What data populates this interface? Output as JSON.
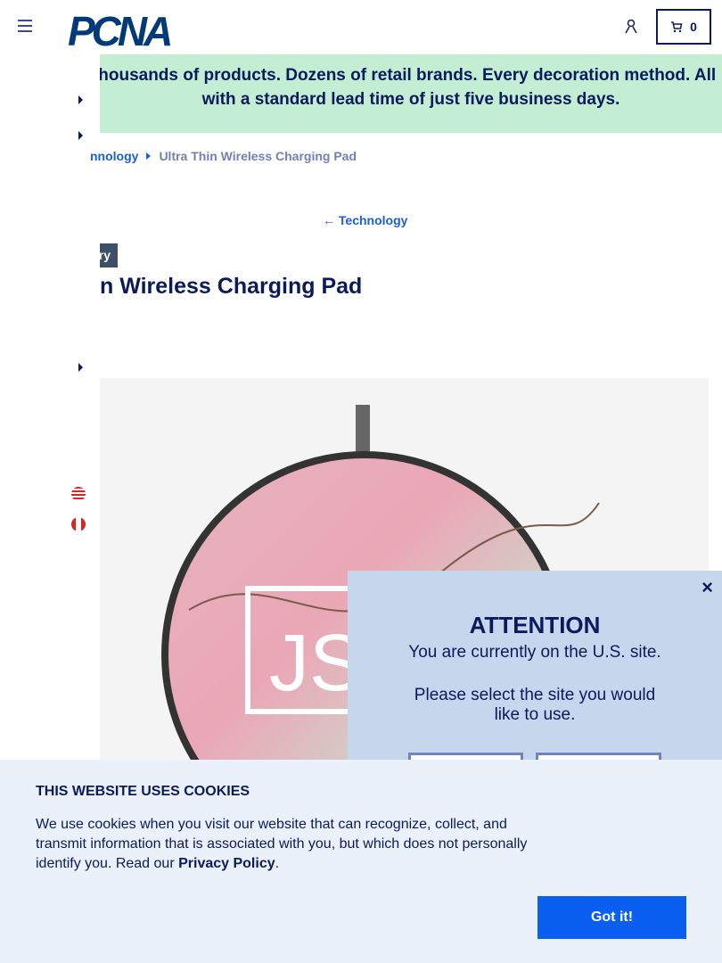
{
  "header": {
    "logo": "PCNA",
    "cart_count": "0"
  },
  "banner": {
    "text_line1": "' Thousands of products. Dozens of retail brands. Every decoration method. All",
    "text_line2": "with a standard lead time of just five business days."
  },
  "breadcrumb": {
    "parent": "nnology",
    "current": "Ultra Thin Wireless Charging Pad"
  },
  "back_link": "Technology",
  "tag": "ry",
  "product_title": "n Wireless Charging Pad",
  "product_image": {
    "monogram": "JS"
  },
  "modal": {
    "title": "ATTENTION",
    "line1": "You are currently on the U.S. site.",
    "line2": "Please select the site you would like to use.",
    "close": "×"
  },
  "cookies": {
    "title": "THIS WEBSITE USES COOKIES",
    "text": "We use cookies when you visit our website that can recognize, collect, and transmit information that is associated with you, but which does not personally identify you. Read our ",
    "link": "Privacy Policy",
    "end": ".",
    "button": "Got it!"
  }
}
